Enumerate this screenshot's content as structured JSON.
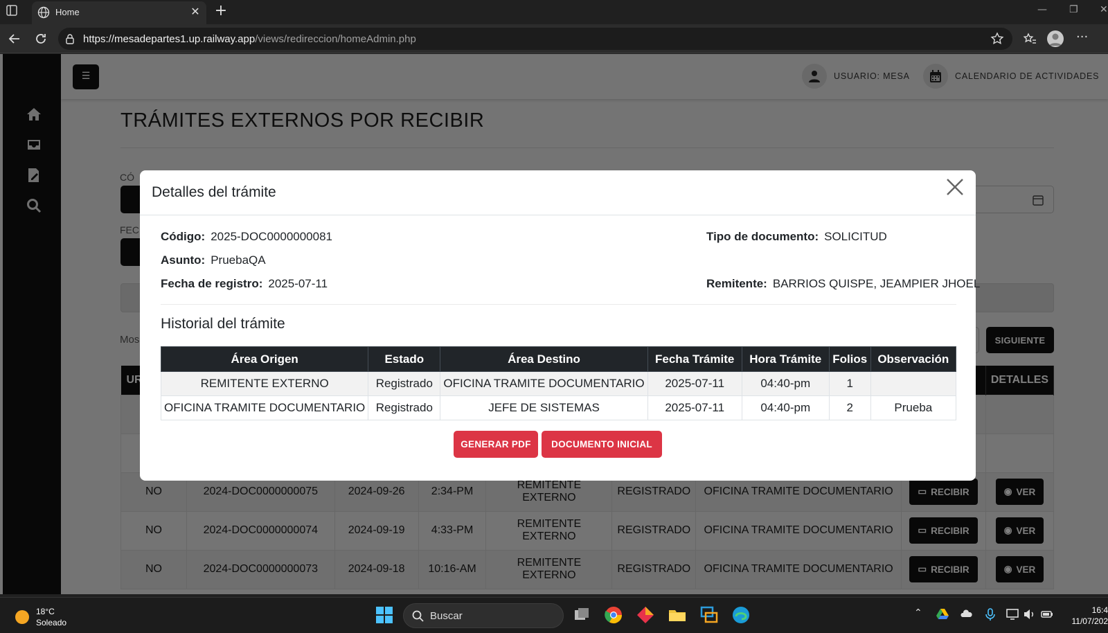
{
  "browser": {
    "tab_title": "Home",
    "url_host": "https://mesadepartes1.up.railway.app",
    "url_path": "/views/redireccion/homeAdmin.php"
  },
  "topnav": {
    "user_label": "USUARIO: MESA",
    "calendar_label": "CALENDARIO DE ACTIVIDADES"
  },
  "page": {
    "title": "TRÁMITES EXTERNOS POR RECIBIR",
    "codigo_label_partial": "CÓ",
    "fecha_label_partial": "FEC",
    "mostrar_partial": "Mos",
    "siguiente_label": "SIGUIENTE"
  },
  "bg_table": {
    "headers": [
      "UR",
      "DETALLES"
    ],
    "recibir_label": "RECIBIR",
    "ver_label": "VER",
    "rows": [
      [
        "NO",
        "2024-DOC0000000075",
        "2024-09-26",
        "2:34-PM",
        "REMITENTE EXTERNO",
        "REGISTRADO",
        "OFICINA TRAMITE DOCUMENTARIO"
      ],
      [
        "NO",
        "2024-DOC0000000074",
        "2024-09-19",
        "4:33-PM",
        "REMITENTE EXTERNO",
        "REGISTRADO",
        "OFICINA TRAMITE DOCUMENTARIO"
      ],
      [
        "NO",
        "2024-DOC0000000073",
        "2024-09-18",
        "10:16-AM",
        "REMITENTE EXTERNO",
        "REGISTRADO",
        "OFICINA TRAMITE DOCUMENTARIO"
      ]
    ]
  },
  "modal": {
    "title": "Detalles del trámite",
    "codigo_label": "Código:",
    "codigo_value": "2025-DOC0000000081",
    "tipo_label": "Tipo de documento:",
    "tipo_value": "SOLICITUD",
    "asunto_label": "Asunto:",
    "asunto_value": "PruebaQA",
    "fecha_label": "Fecha de registro:",
    "fecha_value": "2025-07-11",
    "remitente_label": "Remitente:",
    "remitente_value": "BARRIOS QUISPE, JEAMPIER JHOEL",
    "historial_title": "Historial del trámite",
    "table_headers": [
      "Área Origen",
      "Estado",
      "Área Destino",
      "Fecha Trámite",
      "Hora Trámite",
      "Folios",
      "Observación"
    ],
    "table_rows": [
      [
        "REMITENTE EXTERNO",
        "Registrado",
        "OFICINA TRAMITE DOCUMENTARIO",
        "2025-07-11",
        "04:40-pm",
        "1",
        ""
      ],
      [
        "OFICINA TRAMITE DOCUMENTARIO",
        "Registrado",
        "JEFE DE SISTEMAS",
        "2025-07-11",
        "04:40-pm",
        "2",
        "Prueba"
      ]
    ],
    "btn_pdf": "GENERAR PDF",
    "btn_documento": "DOCUMENTO INICIAL"
  },
  "taskbar": {
    "temperature": "18°C",
    "weather": "Soleado",
    "search_label": "Buscar",
    "time": "16:4",
    "date": "11/07/202"
  }
}
